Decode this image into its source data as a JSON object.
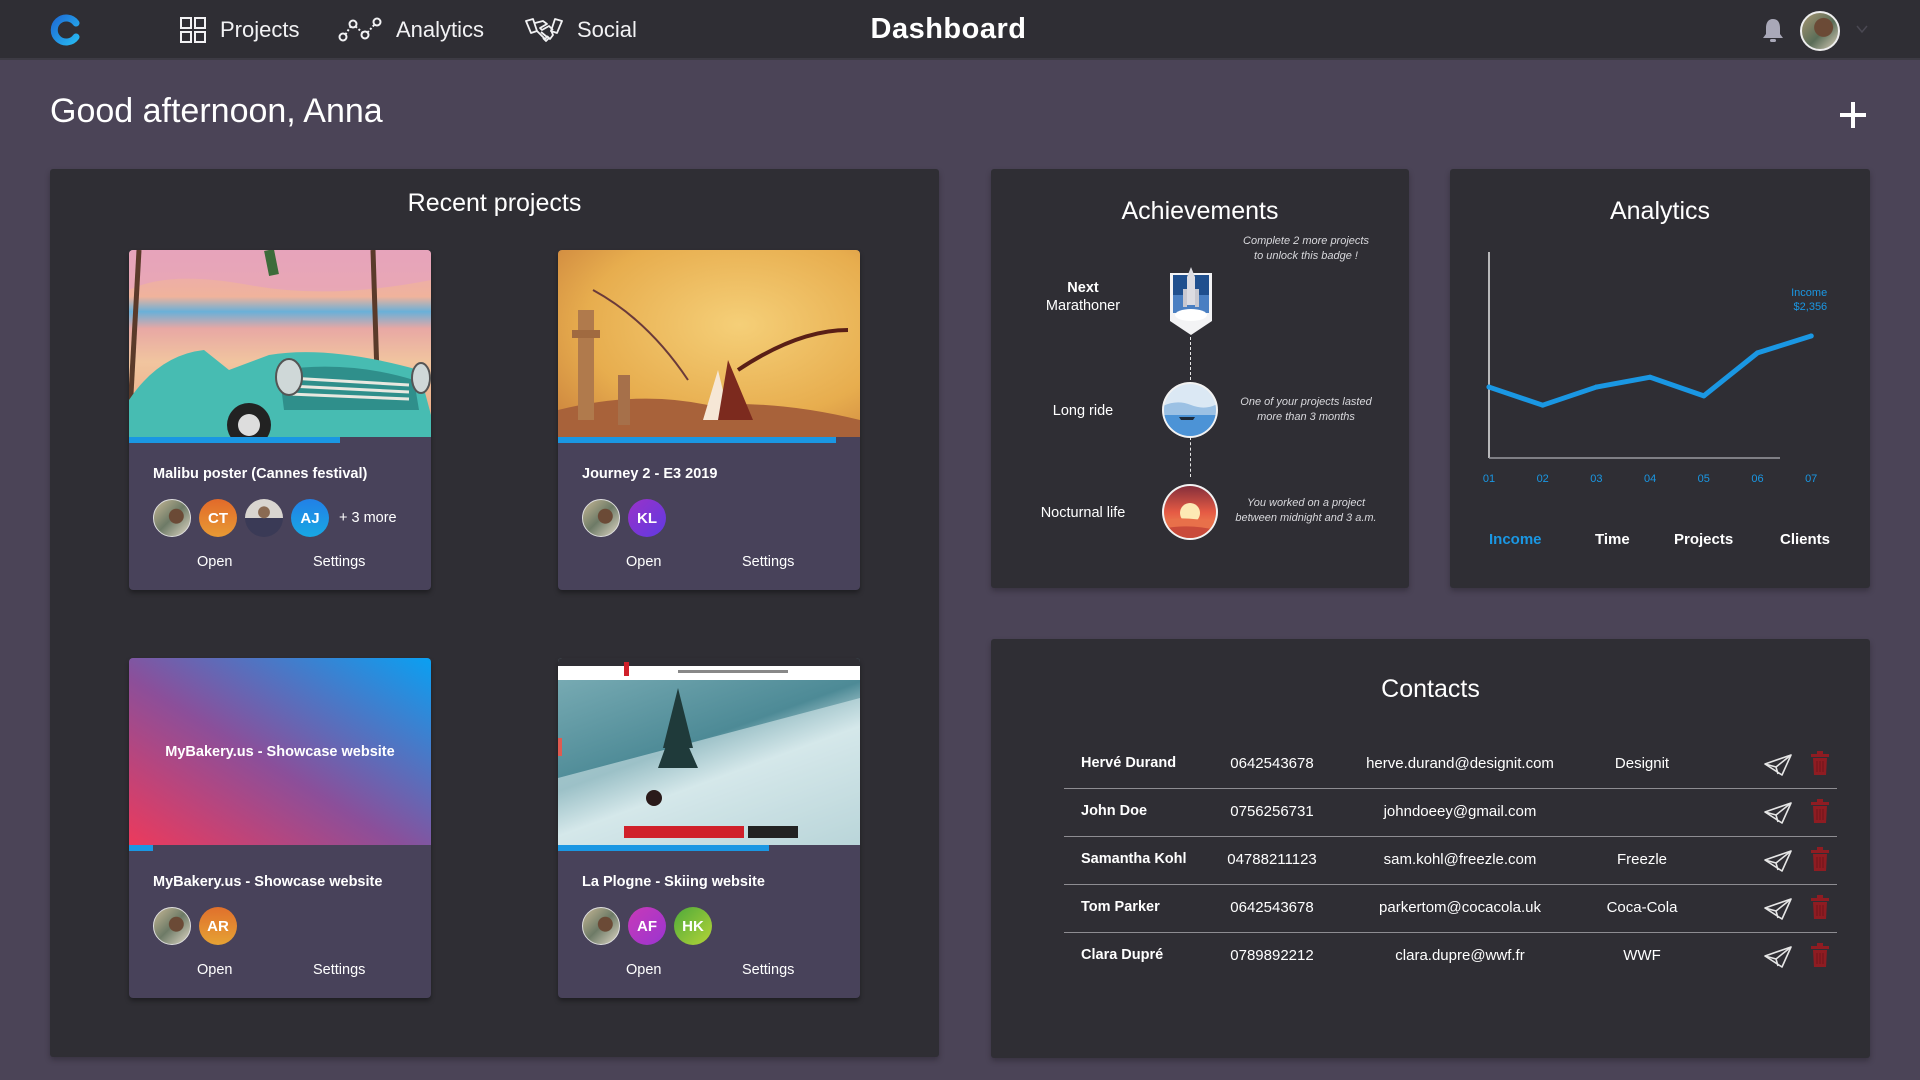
{
  "header": {
    "logo_icon": "c-logo-icon",
    "nav": [
      {
        "label": "Projects",
        "icon": "grid-icon"
      },
      {
        "label": "Analytics",
        "icon": "analytics-nodes-icon"
      },
      {
        "label": "Social",
        "icon": "handshake-icon"
      }
    ],
    "title": "Dashboard",
    "notification_icon": "bell-icon",
    "user_menu_icon": "chevron-down-icon"
  },
  "greeting": "Good afternoon, Anna",
  "add_button_icon": "plus-icon",
  "recent_projects": {
    "title": "Recent projects",
    "open_label": "Open",
    "settings_label": "Settings",
    "cards": [
      {
        "name": "Malibu poster (Cannes festival)",
        "progress": 0.7,
        "members": [
          {
            "type": "photo",
            "initials": ""
          },
          {
            "type": "initials",
            "initials": "CT",
            "color": "#e3782c"
          },
          {
            "type": "photo",
            "initials": ""
          },
          {
            "type": "initials",
            "initials": "AJ",
            "color": "#1a8fe0"
          }
        ],
        "more": "+ 3 more"
      },
      {
        "name": "Journey 2 - E3 2019",
        "progress": 0.92,
        "members": [
          {
            "type": "photo",
            "initials": ""
          },
          {
            "type": "initials",
            "initials": "KL",
            "color": "#7a35d6"
          }
        ],
        "more": ""
      },
      {
        "name": "MyBakery.us - Showcase website",
        "thumbnail_text": "MyBakery.us - Showcase website",
        "progress": 0.08,
        "members": [
          {
            "type": "photo",
            "initials": ""
          },
          {
            "type": "initials",
            "initials": "AR",
            "color": "#e07a2c"
          }
        ],
        "more": ""
      },
      {
        "name": "La Plogne - Skiing website",
        "progress": 0.7,
        "members": [
          {
            "type": "photo",
            "initials": ""
          },
          {
            "type": "initials",
            "initials": "AF",
            "color": "#b23cc4"
          },
          {
            "type": "initials",
            "initials": "HK",
            "color": "#78bd3a"
          }
        ],
        "more": ""
      }
    ]
  },
  "achievements": {
    "title": "Achievements",
    "items": [
      {
        "label_line1": "Next",
        "label_line2": "Marathoner",
        "description_line1": "Complete 2 more projects",
        "description_line2": "to unlock this badge !",
        "icon": "rocket-badge-icon"
      },
      {
        "label_line1": "Long ride",
        "label_line2": "",
        "description_line1": "One of your projects lasted",
        "description_line2": "more than 3 months",
        "icon": "boat-sea-badge-icon"
      },
      {
        "label_line1": "Nocturnal life",
        "label_line2": "",
        "description_line1": "You worked on a project",
        "description_line2": "between midnight and 3 a.m.",
        "icon": "sunset-badge-icon"
      }
    ]
  },
  "analytics": {
    "title": "Analytics",
    "tabs": [
      "Income",
      "Time",
      "Projects",
      "Clients"
    ],
    "active_tab": "Income",
    "accent_color": "#1a97e3"
  },
  "chart_data": {
    "type": "line",
    "title": "",
    "categories": [
      "01",
      "02",
      "03",
      "04",
      "05",
      "06",
      "07"
    ],
    "series": [
      {
        "name": "Income",
        "values": [
          1370,
          1020,
          1370,
          1560,
          1200,
          2030,
          2356
        ]
      }
    ],
    "annotation": {
      "label": "Income",
      "value_text": "$2,356",
      "category": "07"
    },
    "xlabel": "",
    "ylabel": "",
    "ylim": [
      0,
      4000
    ],
    "grid": false,
    "legend": "none"
  },
  "contacts": {
    "title": "Contacts",
    "send_icon": "paper-plane-icon",
    "delete_icon": "trash-icon",
    "rows": [
      {
        "name": "Hervé Durand",
        "phone": "0642543678",
        "email": "herve.durand@designit.com",
        "company": "Designit"
      },
      {
        "name": "John Doe",
        "phone": "0756256731",
        "email": "johndoeey@gmail.com",
        "company": ""
      },
      {
        "name": "Samantha Kohl",
        "phone": "04788211123",
        "email": "sam.kohl@freezle.com",
        "company": "Freezle"
      },
      {
        "name": "Tom Parker",
        "phone": "0642543678",
        "email": "parkertom@cocacola.uk",
        "company": "Coca-Cola"
      },
      {
        "name": "Clara Dupré",
        "phone": "0789892212",
        "email": "clara.dupre@wwf.fr",
        "company": "WWF"
      }
    ]
  }
}
